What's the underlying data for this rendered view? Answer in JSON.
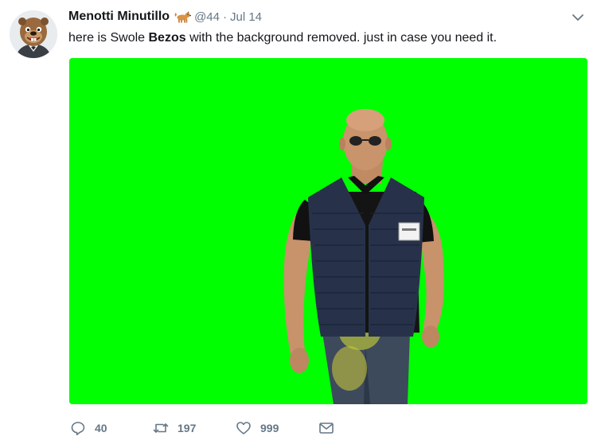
{
  "tweet": {
    "author_name": "Menotti Minutillo",
    "handle": "@44",
    "separator": "·",
    "date": "Jul 14",
    "text_before": "here is Swole ",
    "text_bold": "Bezos",
    "text_after": " with the background removed. just in case you need it.",
    "media": {
      "background_color": "#00ff00",
      "subject": "man-in-quilted-vest"
    }
  },
  "actions": {
    "reply_count": "40",
    "retweet_count": "197",
    "like_count": "999"
  },
  "colors": {
    "text": "#14171a",
    "secondary": "#657786",
    "media_green": "#00ff00"
  },
  "icons": [
    "avatar-beaver",
    "dog-emoji",
    "chevron-down",
    "reply-icon",
    "retweet-icon",
    "like-icon",
    "message-icon"
  ]
}
